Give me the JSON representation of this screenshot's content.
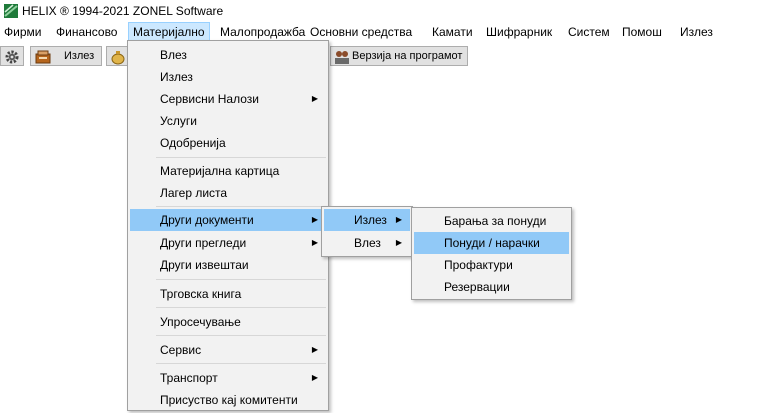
{
  "window": {
    "title": "HELIX ® 1994-2021  ZONEL Software"
  },
  "menubar": {
    "items": [
      "Фирми",
      "Финансово",
      "Материјално",
      "Малопродажба",
      "Основни средства",
      "Камати",
      "Шифрарник",
      "Систем",
      "Помош",
      "Излез"
    ],
    "active": "Материјално"
  },
  "toolbar": {
    "exit_label": "Излез",
    "version_label": "Верзија на програмот"
  },
  "menu_materijalno": {
    "items": [
      "Влез",
      "Излез",
      "Сервисни Налози",
      "Услуги",
      "Одобренија",
      "Материјална картица",
      "Лагер листа",
      "Други документи",
      "Други прегледи",
      "Други извештаи",
      "Трговска книга",
      "Упросечување",
      "Сервис",
      "Транспорт",
      "Присуство кај комитенти"
    ]
  },
  "submenu_drugi": {
    "items": [
      "Излез",
      "Влез"
    ]
  },
  "submenu_izlez": {
    "items": [
      "Барања за понуди",
      "Понуди / нарачки",
      "Профактури",
      "Резервации"
    ]
  },
  "colors": {
    "highlight": "#91c9f7",
    "menu_bg": "#f2f2f2",
    "active_menu": "#cce8ff"
  }
}
